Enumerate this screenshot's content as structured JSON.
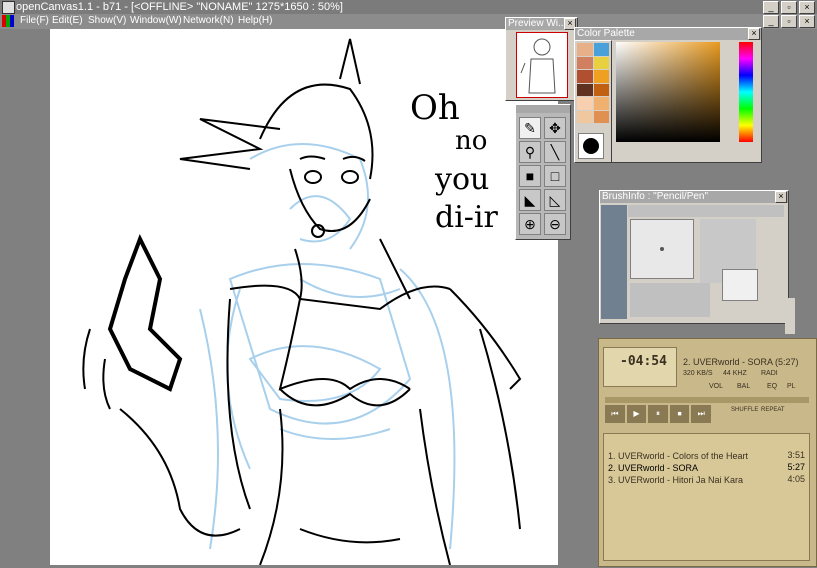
{
  "window": {
    "title": "openCanvas1.1 - b71 - [<OFFLINE> \"NONAME\" 1275*1650 : 50%]"
  },
  "menu": [
    "File(F)",
    "Edit(E)",
    "Show(V)",
    "Window(W)",
    "Network(N)",
    "Help(H)"
  ],
  "panels": {
    "preview_title": "Preview Wi...",
    "palette_title": "Color Palette",
    "brush_title": "BrushInfo : \"Pencil/Pen\""
  },
  "player": {
    "time": "-04:54",
    "track_title": "2. UVERworld - SORA (5:27)",
    "kbps": "320 KB/S",
    "khz": "44 KHZ",
    "radio": "RADI",
    "vol": "VOL",
    "bal": "BAL",
    "eq": "EQ",
    "pl": "PL",
    "shuffle": "SHUFFLE",
    "repeat": "REPEAT",
    "playlist": [
      {
        "label": "1. UVERworld - Colors of the Heart",
        "time": "3:51"
      },
      {
        "label": "2. UVERworld - SORA",
        "time": "5:27"
      },
      {
        "label": "3. UVERworld - Hitori Ja Nai Kara",
        "time": "4:05"
      }
    ]
  },
  "sketch": {
    "text1": "Oh",
    "text2": "no",
    "text3": "you",
    "text4": "di-ir"
  }
}
